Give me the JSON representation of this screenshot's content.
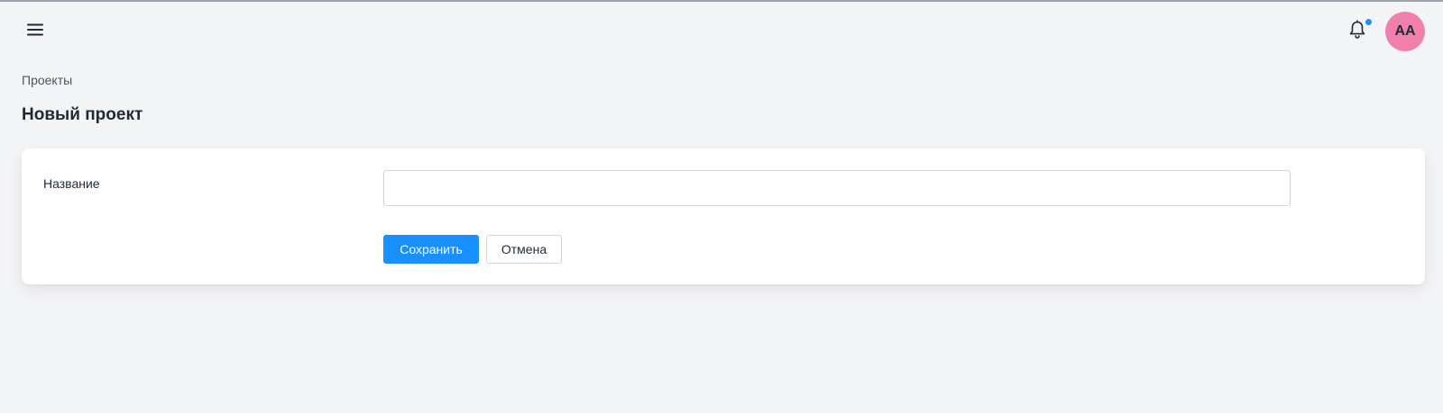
{
  "header": {
    "menu_icon": "hamburger-menu-icon",
    "bell_icon": "bell-icon",
    "avatar_initials": "AA"
  },
  "breadcrumb": {
    "label": "Проекты"
  },
  "page": {
    "title": "Новый проект"
  },
  "form": {
    "name_label": "Название",
    "name_value": "",
    "name_placeholder": "",
    "save_label": "Сохранить",
    "cancel_label": "Отмена"
  },
  "colors": {
    "accent": "#1890ff",
    "notification_dot": "#1890ff",
    "avatar_bg": "#f17fac",
    "background": "#f3f4f6",
    "card": "#ffffff"
  }
}
